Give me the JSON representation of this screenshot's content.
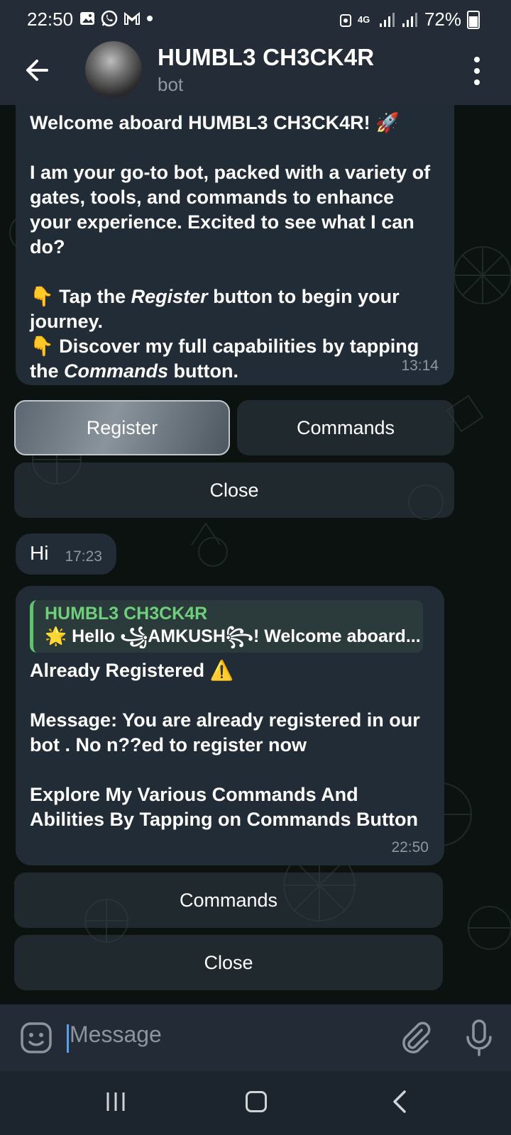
{
  "status_bar": {
    "time": "22:50",
    "network": "4G",
    "battery": "72%",
    "left_icons": [
      "gallery-icon",
      "whatsapp-icon",
      "gmail-icon",
      "dot-icon"
    ]
  },
  "header": {
    "title": "HUMBL3 CH3CK4R",
    "subtitle": "bot"
  },
  "messages": {
    "welcome": {
      "line1": "Welcome aboard HUMBL3 CH3CK4R! 🚀",
      "para2": "I am your go-to bot, packed with a variety of gates, tools, and commands to enhance your experience. Excited to see what I can do?",
      "bullet1_pre": "👇 Tap the ",
      "bullet1_em": "Register",
      "bullet1_post": " button to begin your journey.",
      "bullet2_pre": "👇 Discover my full capabilities by tapping the ",
      "bullet2_em": "Commands",
      "bullet2_post": " button.",
      "time": "13:14"
    },
    "welcome_buttons": {
      "register": "Register",
      "commands": "Commands",
      "close": "Close"
    },
    "user_hi": {
      "text": "Hi",
      "time": "17:23"
    },
    "registered": {
      "reply_name": "HUMBL3 CH3CK4R",
      "reply_text": "🌟 Hello ꧁AMKUSH꧂!  Welcome aboard...",
      "line1": "Already Registered ⚠️",
      "line2": "Message: You are already registered in our bot . No n??ed to register now",
      "line3": "Explore My Various Commands And Abilities By Tapping on Commands Button",
      "time": "22:50"
    },
    "registered_buttons": {
      "commands": "Commands",
      "close": "Close"
    }
  },
  "input": {
    "placeholder": "Message"
  },
  "colors": {
    "header_bg": "#232c37",
    "bubble_bg": "#222c37",
    "reply_accent": "#5fc56a",
    "caret": "#4fa3ff"
  }
}
